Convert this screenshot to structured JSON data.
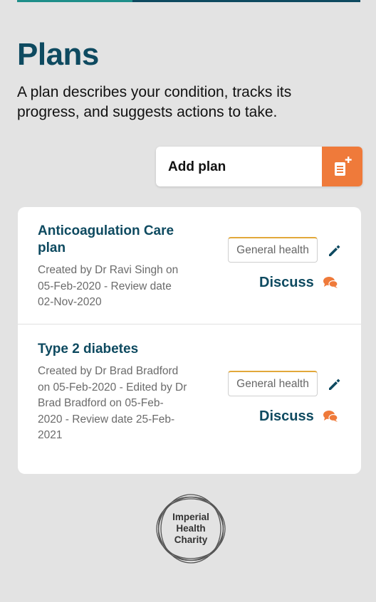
{
  "header": {
    "title": "Plans",
    "description": "A plan describes your condition, tracks its progress, and suggests actions to take."
  },
  "add_plan": {
    "label": "Add plan",
    "icon": "add-document-icon"
  },
  "plans": [
    {
      "title": "Anticoagulation Care plan",
      "meta": "Created by Dr Ravi Singh on 05-Feb-2020 - Review date 02-Nov-2020",
      "tag": "General health",
      "discuss_label": "Discuss"
    },
    {
      "title": "Type 2 diabetes",
      "meta": "Created by Dr Brad Bradford on 05-Feb-2020 - Edited by Dr Brad Bradford on 05-Feb-2020 - Review date 25-Feb-2021",
      "tag": "General health",
      "discuss_label": "Discuss"
    }
  ],
  "footer": {
    "logo_lines": [
      "Imperial",
      "Health",
      "Charity"
    ]
  },
  "colors": {
    "primary": "#0e4a60",
    "accent": "#ef7a3a",
    "tag_border": "#e2a83a",
    "background": "#e3e3e3"
  }
}
